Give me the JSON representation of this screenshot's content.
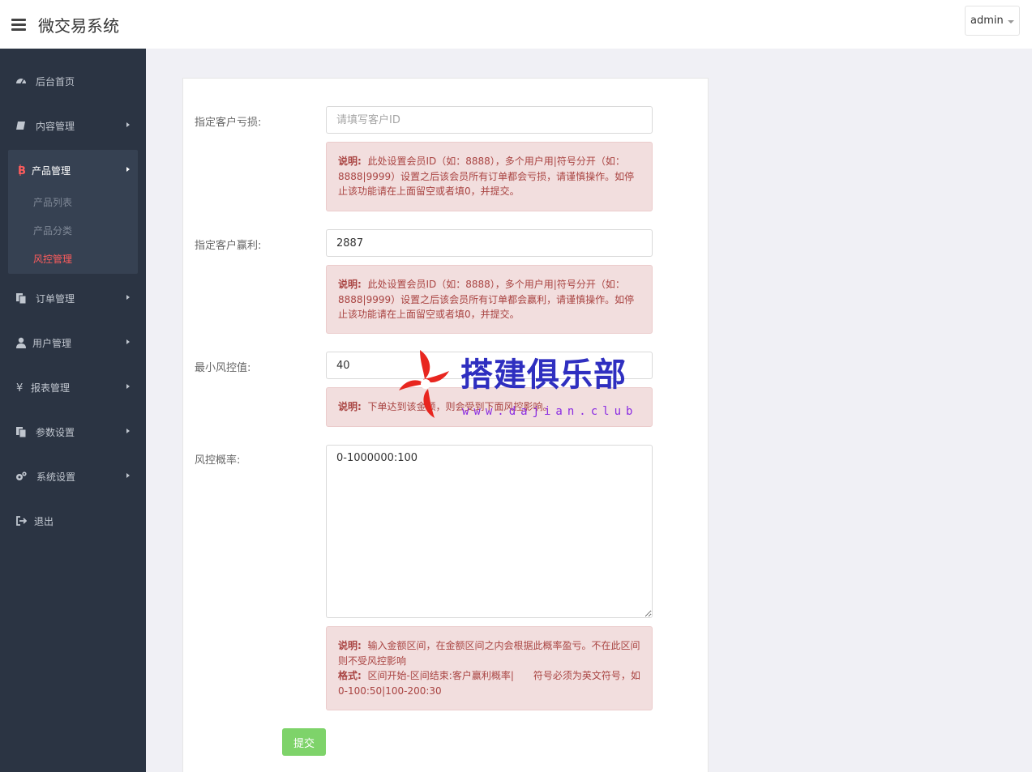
{
  "header": {
    "title": "微交易系统",
    "user": "admin"
  },
  "sidebar": {
    "items": [
      {
        "label": "后台首页",
        "icon": "dashboard-icon"
      },
      {
        "label": "内容管理",
        "icon": "book-icon"
      },
      {
        "label": "产品管理",
        "icon": "bitcoin-icon"
      },
      {
        "label": "订单管理",
        "icon": "copy-icon"
      },
      {
        "label": "用户管理",
        "icon": "user-icon"
      },
      {
        "label": "报表管理",
        "icon": "yen-icon"
      },
      {
        "label": "参数设置",
        "icon": "copy-icon"
      },
      {
        "label": "系统设置",
        "icon": "gears-icon"
      },
      {
        "label": "退出",
        "icon": "sign-out-icon"
      }
    ],
    "product_sub": [
      {
        "label": "产品列表"
      },
      {
        "label": "产品分类"
      },
      {
        "label": "风控管理",
        "active": true
      }
    ],
    "active_color": "#ff5c5c"
  },
  "form": {
    "loss_label": "指定客户亏损:",
    "loss_placeholder": "请填写客户ID",
    "loss_value": "",
    "loss_note_title": "说明:",
    "loss_note": "此处设置会员ID（如：8888），多个用户用|符号分开（如：8888|9999）设置之后该会员所有订单都会亏损，请谨慎操作。如停止该功能请在上面留空或者填0，并提交。",
    "win_label": "指定客户赢利:",
    "win_value": "2887",
    "win_note_title": "说明:",
    "win_note": "此处设置会员ID（如：8888），多个用户用|符号分开（如：8888|9999）设置之后该会员所有订单都会赢利，请谨慎操作。如停止该功能请在上面留空或者填0，并提交。",
    "min_label": "最小风控值:",
    "min_value": "40",
    "min_note_title": "说明:",
    "min_note": "下单达到该金额，则会受到下面风控影响。",
    "rate_label": "风控概率:",
    "rate_value": "0-1000000:100",
    "rate_note_title": "说明:",
    "rate_note": "输入金额区间，在金额区间之内会根据此概率盈亏。不在此区间则不受风控影响",
    "rate_format_title": "格式:",
    "rate_format": "区间开始-区间结束:客户赢利概率|　　符号必须为英文符号，如0-100:50|100-200:30",
    "submit": "提交",
    "submit_color": "#7ed36a"
  },
  "watermark": {
    "text": "搭建俱乐部",
    "url": "www.dajian.club"
  }
}
